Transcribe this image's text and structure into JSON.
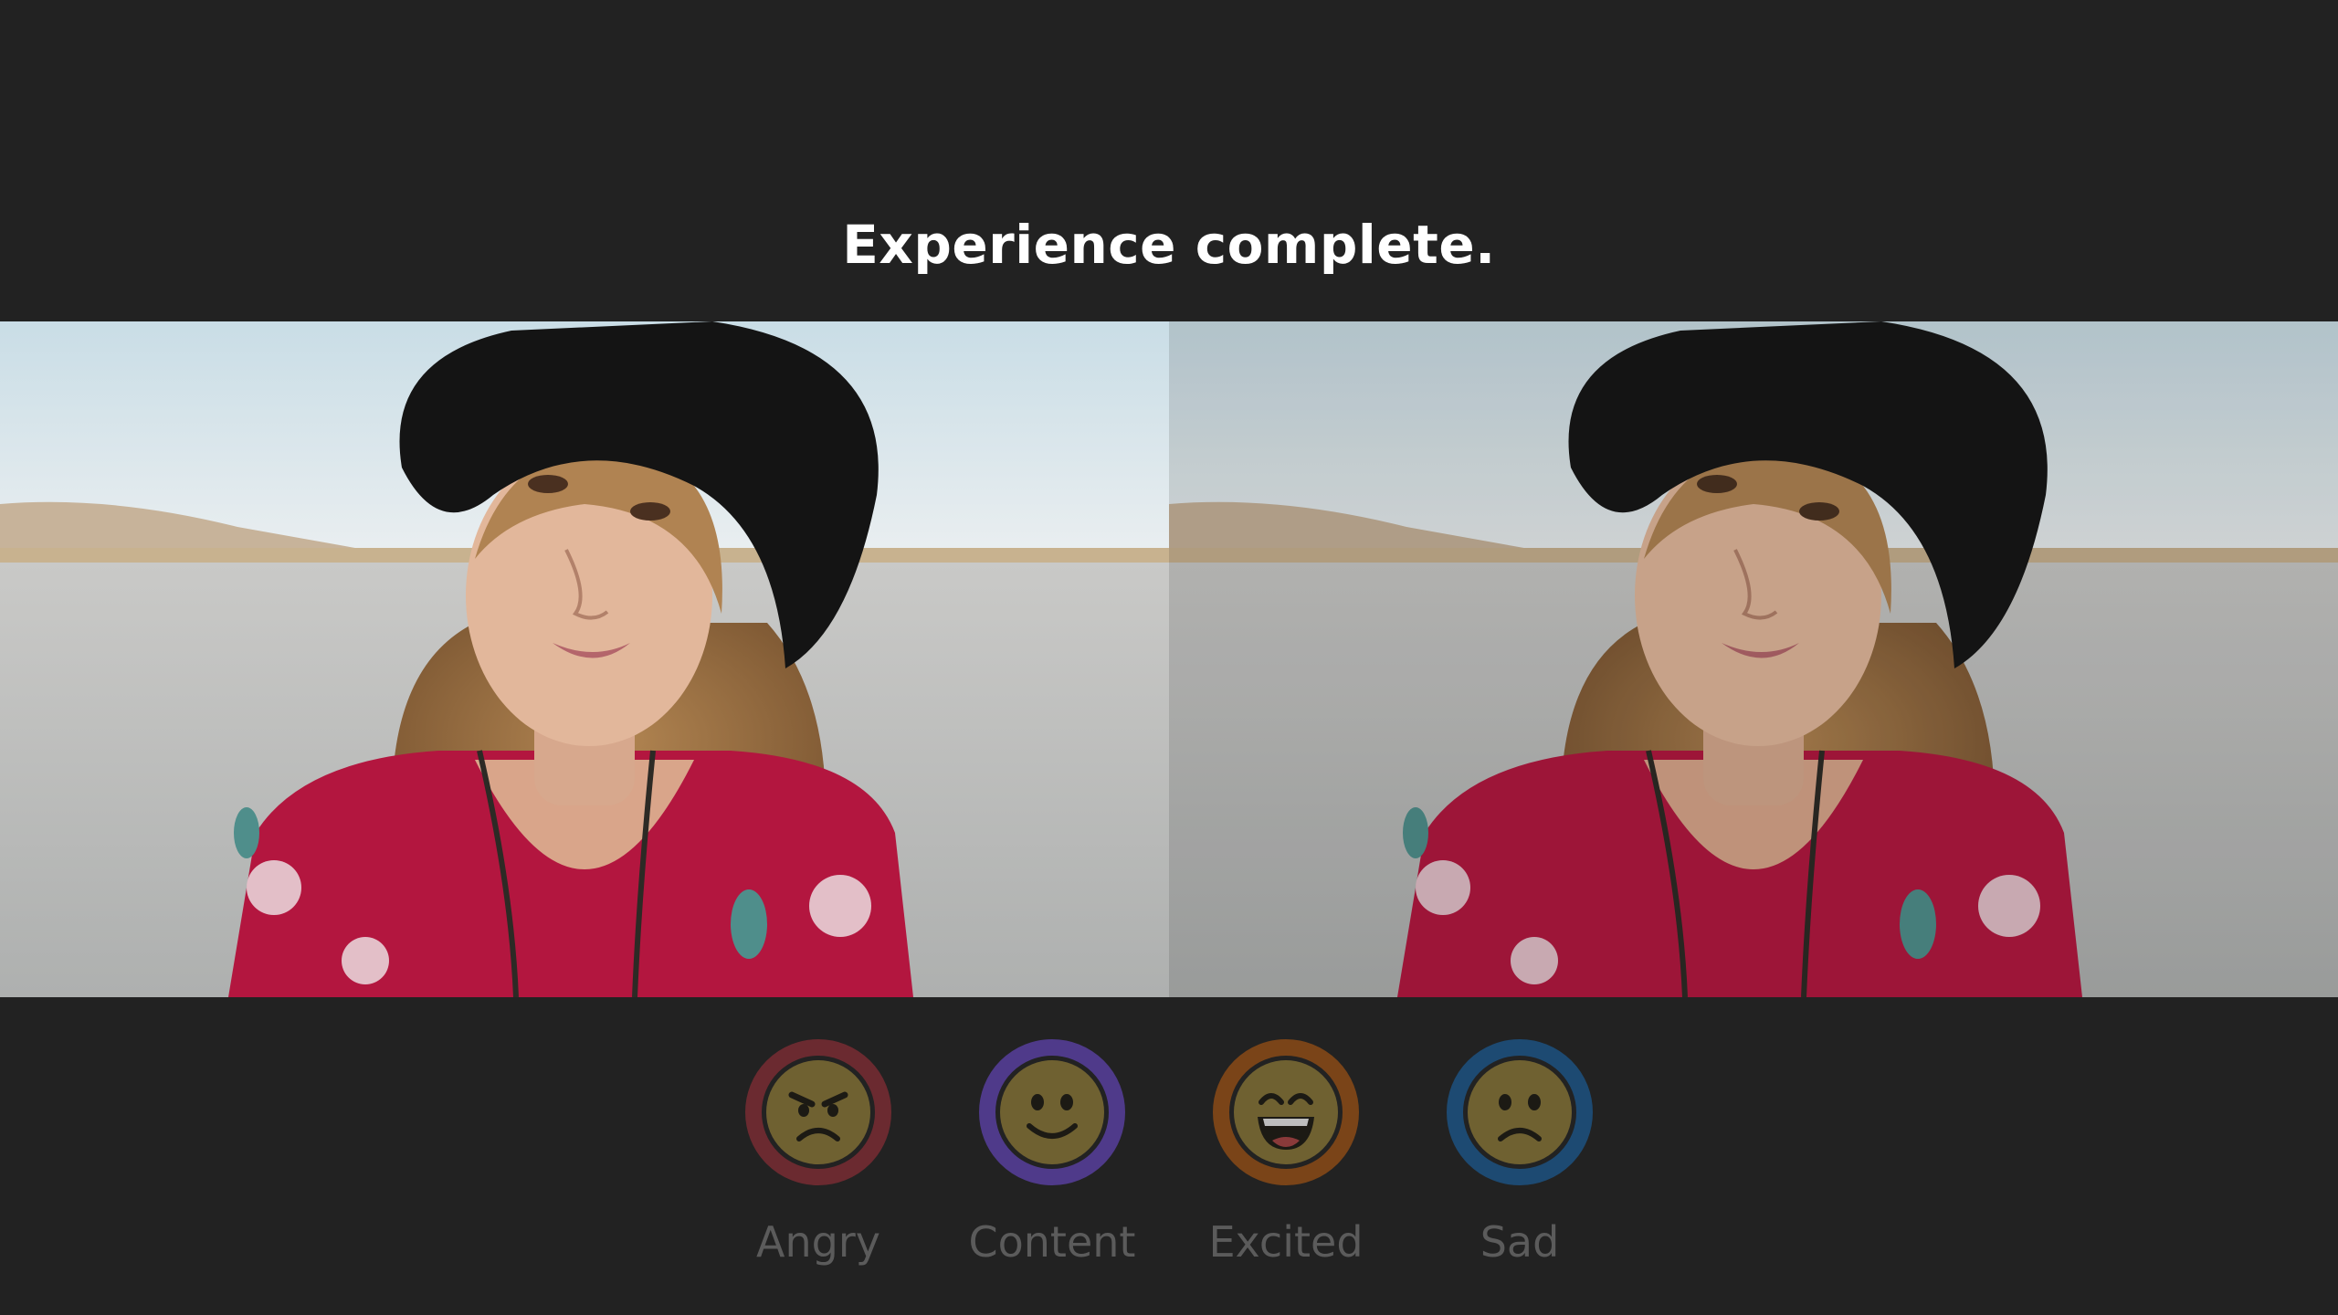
{
  "heading": "Experience complete.",
  "photos": [
    {
      "name": "portrait-original",
      "icon": "woman-portrait-image"
    },
    {
      "name": "portrait-filtered",
      "icon": "woman-portrait-image"
    }
  ],
  "emotions": [
    {
      "label": "Angry",
      "icon": "angry-face-icon",
      "ring_color": "#6b2a30"
    },
    {
      "label": "Content",
      "icon": "smiling-face-icon",
      "ring_color": "#4f3a8a"
    },
    {
      "label": "Excited",
      "icon": "grinning-face-icon",
      "ring_color": "#7a4418"
    },
    {
      "label": "Sad",
      "icon": "sad-face-icon",
      "ring_color": "#1d4a72"
    }
  ],
  "colors": {
    "background": "#222222",
    "heading_text": "#ffffff",
    "label_text": "#5b5b5b",
    "face_fill": "#6f6131"
  }
}
